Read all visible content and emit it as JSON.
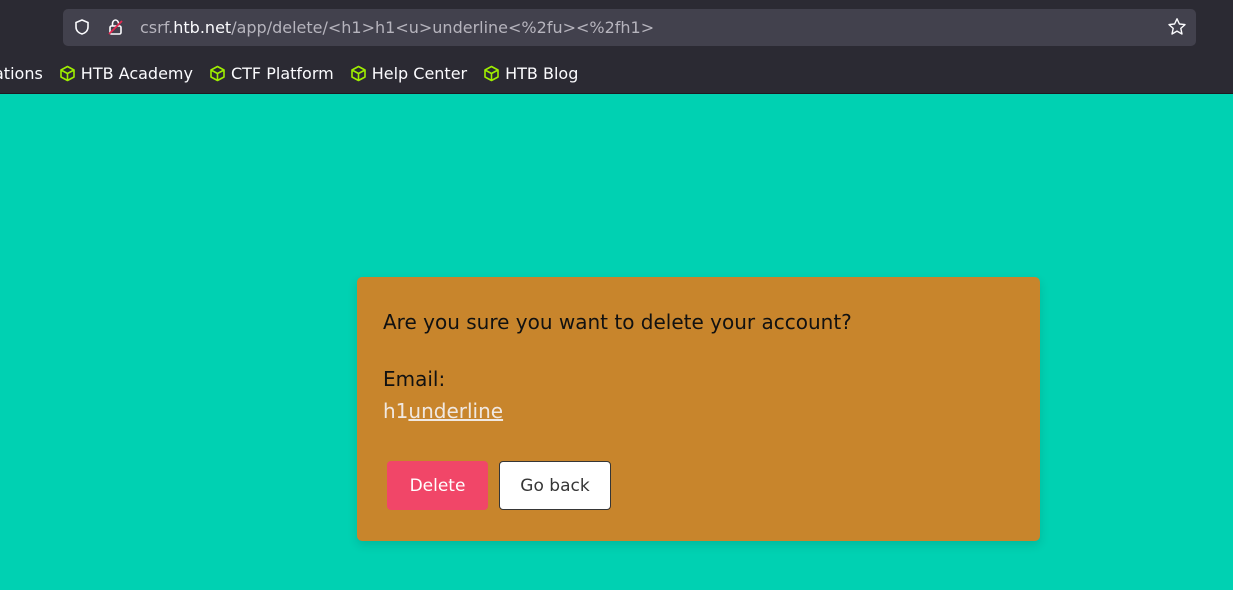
{
  "browser": {
    "url_prefix": "csrf.",
    "url_host": "htb.net",
    "url_path": "/app/delete/<h1>h1<u>underline<%2fu><%2fh1>",
    "bookmarks_partial": "ations",
    "bookmarks": [
      {
        "label": "HTB Academy",
        "icon": "cube-icon"
      },
      {
        "label": "CTF Platform",
        "icon": "cube-icon"
      },
      {
        "label": "Help Center",
        "icon": "cube-icon"
      },
      {
        "label": "HTB Blog",
        "icon": "cube-icon"
      }
    ],
    "bookmark_icon_color": "#9fef00"
  },
  "dialog": {
    "question": "Are you sure you want to delete your account?",
    "email_label": "Email:",
    "email_value_plain": "h1",
    "email_value_underlined": "underline",
    "delete_label": "Delete",
    "back_label": "Go back"
  },
  "colors": {
    "page_bg": "#00d1b2",
    "card_bg": "#c8852c",
    "delete_bg": "#f14668"
  }
}
